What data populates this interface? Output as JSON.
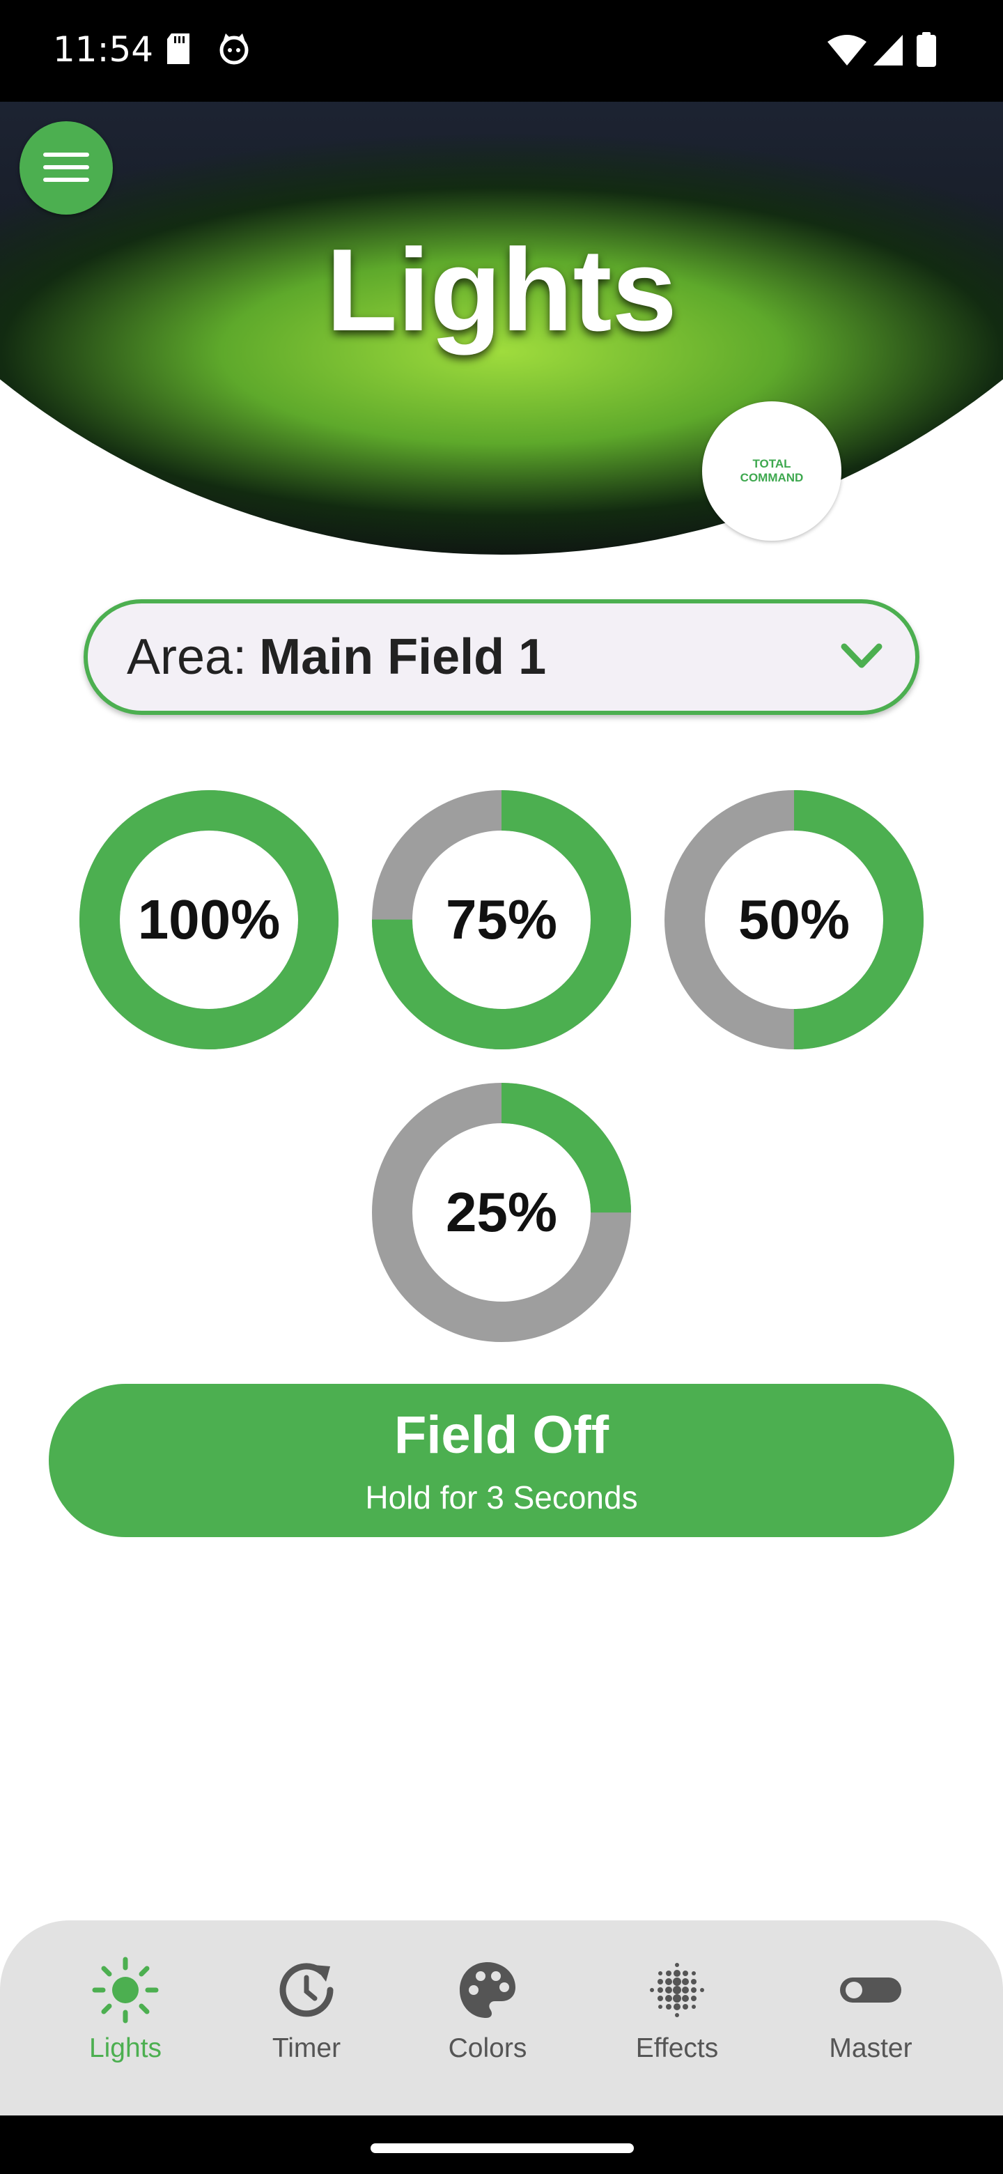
{
  "status_bar": {
    "time": "11:54",
    "icons": [
      "sd-card-icon",
      "cat-face-icon",
      "wifi-icon",
      "signal-icon",
      "battery-icon"
    ]
  },
  "header": {
    "title": "Lights",
    "menu_icon": "hamburger-menu-icon",
    "logo_lines": [
      "TOTAL",
      "COMMAND"
    ]
  },
  "area_selector": {
    "label": "Area:",
    "value": "Main Field 1",
    "icon": "chevron-down-icon"
  },
  "levels": [
    {
      "label": "100%",
      "fraction": 1.0
    },
    {
      "label": "75%",
      "fraction": 0.75
    },
    {
      "label": "50%",
      "fraction": 0.5
    },
    {
      "label": "25%",
      "fraction": 0.25
    }
  ],
  "field_off": {
    "title": "Field Off",
    "subtitle": "Hold for 3 Seconds"
  },
  "bottom_nav": {
    "items": [
      {
        "label": "Lights",
        "icon": "sun-icon",
        "active": true
      },
      {
        "label": "Timer",
        "icon": "timer-icon",
        "active": false
      },
      {
        "label": "Colors",
        "icon": "palette-icon",
        "active": false
      },
      {
        "label": "Effects",
        "icon": "dot-grid-icon",
        "active": false
      },
      {
        "label": "Master",
        "icon": "toggle-icon",
        "active": false
      }
    ]
  },
  "colors": {
    "accent": "#4caf50",
    "gauge_track": "#9e9e9e",
    "nav_background": "#e2e2e2",
    "selector_background": "#f3f0f6"
  }
}
